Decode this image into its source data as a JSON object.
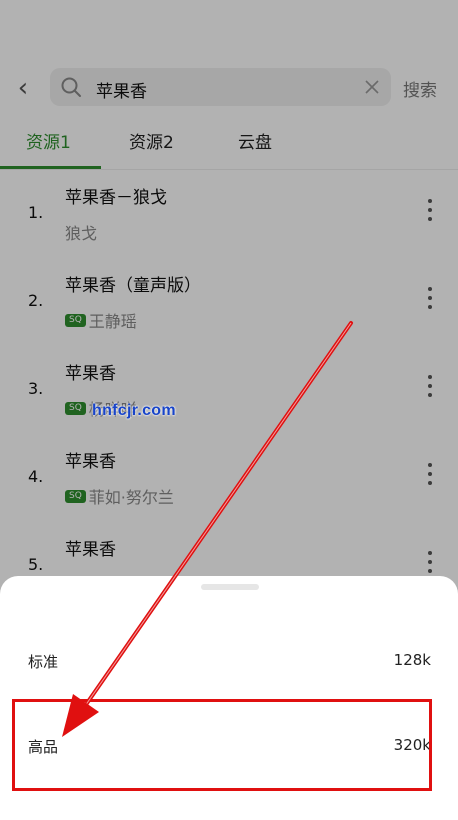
{
  "search": {
    "query": "苹果香",
    "button_label": "搜索"
  },
  "tabs": [
    {
      "label": "资源1",
      "active": true
    },
    {
      "label": "资源2",
      "active": false
    },
    {
      "label": "云盘",
      "active": false
    }
  ],
  "results": [
    {
      "index": "1.",
      "title": "苹果香－狼戈",
      "artist": "狼戈",
      "quality_badge": ""
    },
    {
      "index": "2.",
      "title": "苹果香（童声版）",
      "artist": "王静瑶",
      "quality_badge": "SQ"
    },
    {
      "index": "3.",
      "title": "苹果香",
      "artist": "杨咩咩",
      "quality_badge": "SQ"
    },
    {
      "index": "4.",
      "title": "苹果香",
      "artist": "菲如·努尔兰",
      "quality_badge": "SQ"
    },
    {
      "index": "5.",
      "title": "苹果香",
      "artist": "",
      "quality_badge": ""
    }
  ],
  "watermark": "hnfcjr.com",
  "quality_sheet": {
    "options": [
      {
        "label": "标准",
        "bitrate": "128k"
      },
      {
        "label": "高品",
        "bitrate": "320k",
        "highlighted": true
      }
    ]
  },
  "colors": {
    "accent": "#2f8f2f",
    "annotation_red": "#e01010",
    "watermark_blue": "#1844c9"
  }
}
